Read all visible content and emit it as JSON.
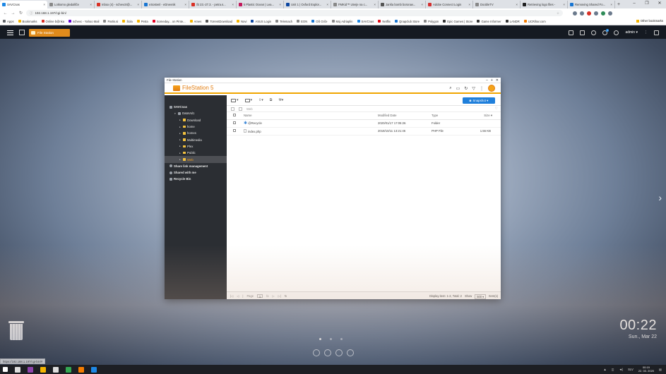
{
  "browser": {
    "tabs": [
      {
        "title": "SAVCnas",
        "color": "#1e88e5",
        "active": true
      },
      {
        "title": "Lotkomo gledalšče",
        "color": "#888888"
      },
      {
        "title": "Inbox (4) - schevc8@...",
        "color": "#d93025"
      },
      {
        "title": "eSostenl - eDnevnik",
        "color": "#1976d2"
      },
      {
        "title": "Št 23.-27.3. - petra.s...",
        "color": "#d93025"
      },
      {
        "title": "k Plastic Ocean | Lea...",
        "color": "#c2185b"
      },
      {
        "title": "Unit 1 | Oxford Explor...",
        "color": "#0d47a1"
      },
      {
        "title": "FMKid™ Uterje na c...",
        "color": "#888888"
      },
      {
        "title": "Janša bomb boronav...",
        "color": "#555555"
      },
      {
        "title": "Adobe Connect Login",
        "color": "#d32f2f"
      },
      {
        "title": "DoobleTV",
        "color": "#888888"
      },
      {
        "title": "Retrieving logo files -",
        "color": "#222222"
      },
      {
        "title": "Removing Shared Fo...",
        "color": "#1976d2"
      }
    ],
    "address": "192.168.1.197/cgi-bin/",
    "bookmarks": [
      {
        "label": "Apps",
        "color": "#5f6368"
      },
      {
        "label": "Bookmarks",
        "color": "#f4b400"
      },
      {
        "label": "Online b@nka",
        "color": "#d93025"
      },
      {
        "label": "schevc - Yahoo Mail",
        "color": "#6001d2"
      },
      {
        "label": "Partis.si",
        "color": "#888888"
      },
      {
        "label": "Šola",
        "color": "#f4b400"
      },
      {
        "label": "Petra",
        "color": "#f4b400"
      },
      {
        "label": "Someday... on Pinte...",
        "color": "#e60023"
      },
      {
        "label": "Ames",
        "color": "#f4b400"
      },
      {
        "label": "TorrentDownload",
        "color": "#555555"
      },
      {
        "label": "Novi",
        "color": "#f4b400"
      },
      {
        "label": "ASUS Login",
        "color": "#0d47a1"
      },
      {
        "label": "Telemach",
        "color": "#888888"
      },
      {
        "label": "EON",
        "color": "#888888"
      },
      {
        "label": "OŠ Grče",
        "color": "#1976d2"
      },
      {
        "label": "Moj Adriaplin",
        "color": "#888888"
      },
      {
        "label": "SAVCnas",
        "color": "#1e88e5"
      },
      {
        "label": "Netflix",
        "color": "#e50914"
      },
      {
        "label": "Qnapclub Store",
        "color": "#1976d2"
      },
      {
        "label": "Polygon",
        "color": "#888888"
      },
      {
        "label": "Epic Games | Store",
        "color": "#333333"
      },
      {
        "label": "Game Informer",
        "color": "#333333"
      },
      {
        "label": "LANDR",
        "color": "#333333"
      },
      {
        "label": "UCRihar.com",
        "color": "#f57c00"
      }
    ],
    "other_bookmarks": "Other bookmarks"
  },
  "qts": {
    "app_tab": "File Station",
    "user": "admin ▾",
    "desktop_icons": [
      {
        "name": "control-panel-app-icon",
        "bg": "#ffffff",
        "fg": "#444444",
        "glyph": "⚙"
      },
      {
        "name": "hd-station-app-icon",
        "bg": "#b03ab5",
        "fg": "#ffffff",
        "glyph": "H"
      },
      {
        "name": "file-station-app-icon",
        "bg": "#f39a12",
        "fg": "#ffffff",
        "glyph": "▬"
      },
      {
        "name": "hybrid-backup-app-icon",
        "bg": "#1b2a4a",
        "fg": "#ffffff",
        "glyph": "HBS"
      },
      {
        "name": "myqnapcloud-app-icon",
        "bg": "#ffffff",
        "fg": "#1e88e5",
        "glyph": "◎"
      },
      {
        "name": "qfinder-app-icon",
        "bg": "#ffffff",
        "fg": "#c2185b",
        "glyph": "◉"
      }
    ],
    "clock_time": "00:22",
    "clock_date": "Sun., Mar 22",
    "status_url": "https://192.168.1.197/cgi-bin/#"
  },
  "filestation": {
    "window_title": "File Station",
    "brand": "FileStation 5",
    "snapshot_label": "Snapshot ▾",
    "path": "Web",
    "tree": [
      {
        "label": "SAVCnas",
        "indent": 0,
        "bold": true,
        "type": "nas"
      },
      {
        "label": "DataVol1",
        "indent": 1,
        "bold": false,
        "type": "disk"
      },
      {
        "label": "Download",
        "indent": 2,
        "type": "folder"
      },
      {
        "label": "home",
        "indent": 2,
        "type": "folder"
      },
      {
        "label": "homes",
        "indent": 2,
        "type": "folder"
      },
      {
        "label": "Multimedia",
        "indent": 2,
        "type": "folder"
      },
      {
        "label": "Plex",
        "indent": 2,
        "type": "folder"
      },
      {
        "label": "Public",
        "indent": 2,
        "type": "folder"
      },
      {
        "label": "Web",
        "indent": 2,
        "type": "folder",
        "selected": true
      },
      {
        "label": "Share link management",
        "indent": 0,
        "bold": true,
        "type": "link"
      },
      {
        "label": "Shared with me",
        "indent": 0,
        "bold": true,
        "type": "shared"
      },
      {
        "label": "Recycle Bin",
        "indent": 0,
        "bold": true,
        "type": "bin"
      }
    ],
    "columns": {
      "name": "Name",
      "modified": "Modified Date",
      "type": "Type",
      "size": "Size"
    },
    "files": [
      {
        "name": "@Recycle",
        "modified": "2020/01/17 17:05:26",
        "type": "Folder",
        "size": "",
        "icon": "gear"
      },
      {
        "name": "index.php",
        "modified": "2018/10/11 13:21:46",
        "type": "PHP File",
        "size": "1.56 KB",
        "icon": "doc"
      }
    ],
    "footer": {
      "page_label": "Page",
      "page_value": "1",
      "page_total": "/1",
      "display": "Display item: 1-2, Total: 2",
      "show_label": "Show",
      "show_value": "500",
      "items_label": "Item(s)"
    }
  },
  "taskbar": {
    "icons": [
      {
        "name": "start-icon",
        "color": "#ffffff"
      },
      {
        "name": "search-taskbar-icon",
        "color": "#dddddd"
      },
      {
        "name": "maps-pin-icon",
        "color": "#8e44ad"
      },
      {
        "name": "file-explorer-icon",
        "color": "#f4b400"
      },
      {
        "name": "photos-icon",
        "color": "#dddddd"
      },
      {
        "name": "chrome-icon",
        "color": "#34a853"
      },
      {
        "name": "vlc-icon",
        "color": "#f57c00"
      },
      {
        "name": "edge-icon",
        "color": "#1e88e5"
      }
    ],
    "lang": "SLV",
    "time": "00:19",
    "date": "22. 03. 2020"
  }
}
